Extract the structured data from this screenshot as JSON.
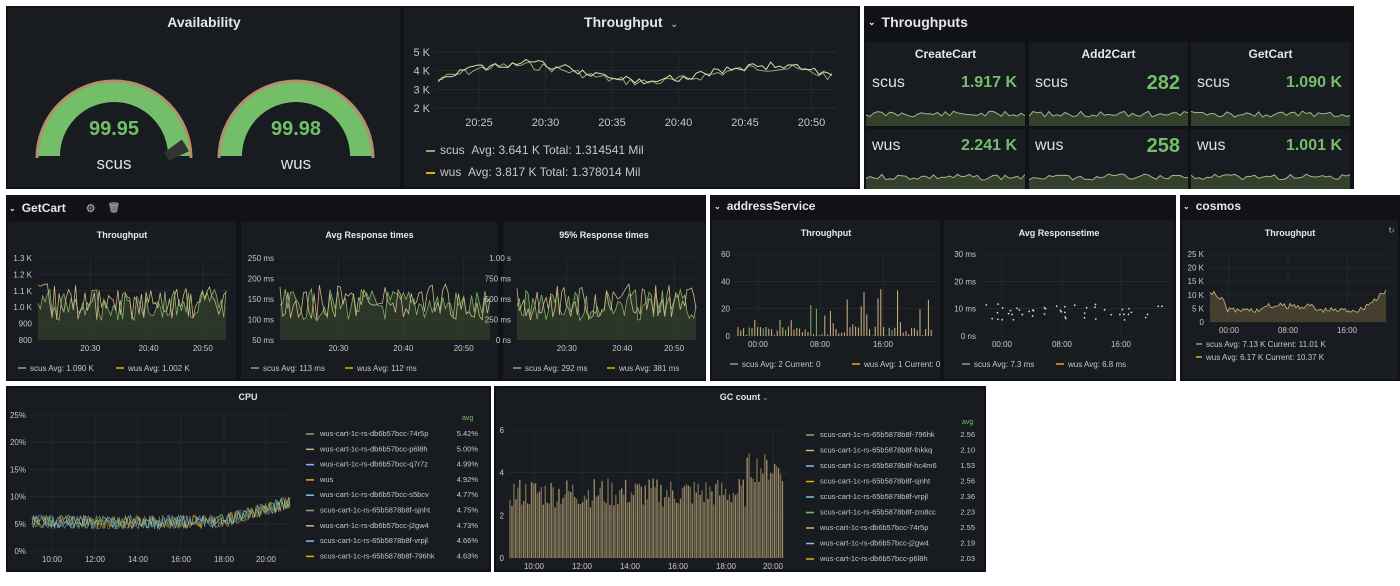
{
  "availability": {
    "title": "Availability",
    "gauges": [
      {
        "value": "99.95",
        "label": "scus",
        "fill": 0.9995
      },
      {
        "value": "99.98",
        "label": "wus",
        "fill": 0.9998
      }
    ]
  },
  "throughput": {
    "title": "Throughput",
    "dropdown_icon": "chevron-down-icon",
    "y_ticks": [
      "5 K",
      "4 K",
      "3 K",
      "2 K"
    ],
    "x_ticks": [
      "20:25",
      "20:30",
      "20:35",
      "20:40",
      "20:45",
      "20:50"
    ],
    "legend": [
      {
        "name": "scus",
        "text": "Avg: 3.641 K  Total: 1.314541 Mil"
      },
      {
        "name": "wus",
        "text": "Avg: 3.817 K  Total: 1.378014 Mil"
      }
    ]
  },
  "throughputs": {
    "row_title": "Throughputs",
    "columns": [
      {
        "title": "CreateCart",
        "rows": [
          {
            "region": "scus",
            "value": "1.917 K"
          },
          {
            "region": "wus",
            "value": "2.241 K"
          }
        ]
      },
      {
        "title": "Add2Cart",
        "rows": [
          {
            "region": "scus",
            "value": "282"
          },
          {
            "region": "wus",
            "value": "258"
          }
        ]
      },
      {
        "title": "GetCart",
        "rows": [
          {
            "region": "scus",
            "value": "1.090 K"
          },
          {
            "region": "wus",
            "value": "1.001 K"
          }
        ]
      }
    ]
  },
  "getcart": {
    "row_title": "GetCart",
    "panels": [
      {
        "title": "Throughput",
        "y_ticks": [
          "1.3 K",
          "1.2 K",
          "1.1 K",
          "1.0 K",
          "900",
          "800"
        ],
        "x_ticks": [
          "20:30",
          "20:40",
          "20:50"
        ],
        "legend": [
          {
            "name": "scus",
            "text": "Avg: 1.090 K"
          },
          {
            "name": "wus",
            "text": "Avg: 1.002 K"
          }
        ]
      },
      {
        "title": "Avg Response times",
        "y_ticks": [
          "250 ms",
          "200 ms",
          "150 ms",
          "100 ms",
          "50 ms"
        ],
        "x_ticks": [
          "20:30",
          "20:40",
          "20:50"
        ],
        "legend": [
          {
            "name": "scus",
            "text": "Avg: 113 ms"
          },
          {
            "name": "wus",
            "text": "Avg: 112 ms"
          }
        ]
      },
      {
        "title": "95% Response times",
        "y_ticks": [
          "1.00 s",
          "750 ms",
          "500 ms",
          "250 ms",
          "0 ns"
        ],
        "x_ticks": [
          "20:30",
          "20:40",
          "20:50"
        ],
        "legend": [
          {
            "name": "scus",
            "text": "Avg: 292 ms"
          },
          {
            "name": "wus",
            "text": "Avg: 381 ms"
          }
        ]
      }
    ]
  },
  "address_service": {
    "row_title": "addressService",
    "panels": [
      {
        "title": "Throughput",
        "y_ticks": [
          "60",
          "40",
          "20",
          "0"
        ],
        "x_ticks": [
          "00:00",
          "08:00",
          "16:00"
        ],
        "legend": [
          {
            "name": "scus",
            "text": "Avg: 2  Current: 0"
          },
          {
            "name": "wus",
            "text": "Avg: 1  Current: 0"
          }
        ]
      },
      {
        "title": "Avg Responsetime",
        "y_ticks": [
          "30 ms",
          "20 ms",
          "10 ms",
          "0 ns"
        ],
        "x_ticks": [
          "00:00",
          "08:00",
          "16:00"
        ],
        "legend": [
          {
            "name": "scus",
            "text": "Avg: 7.3 ms"
          },
          {
            "name": "wus",
            "text": "Avg: 6.8 ms"
          }
        ]
      }
    ]
  },
  "cosmos": {
    "row_title": "cosmos",
    "panel": {
      "title": "Throughput",
      "y_ticks": [
        "25 K",
        "20 K",
        "15 K",
        "10 K",
        "5 K",
        "0"
      ],
      "x_ticks": [
        "00:00",
        "08:00",
        "16:00"
      ],
      "legend": [
        {
          "name": "scus",
          "text": "Avg: 7.13 K  Current: 11.01 K"
        },
        {
          "name": "wus",
          "text": "Avg: 6.17 K  Current: 10.37 K"
        }
      ]
    }
  },
  "cpu": {
    "title": "CPU",
    "y_ticks": [
      "25%",
      "20%",
      "15%",
      "10%",
      "5%",
      "0%"
    ],
    "x_ticks": [
      "10:00",
      "12:00",
      "14:00",
      "16:00",
      "18:00",
      "20:00"
    ],
    "avg_header": "avg",
    "legend": [
      {
        "name": "wus-cart-1c-rs-db6b57bcc-74r5p",
        "avg": "5.42%"
      },
      {
        "name": "wus-cart-1c-rs-db6b57bcc-p6l8h",
        "avg": "5.00%"
      },
      {
        "name": "wus-cart-1c-rs-db6b57bcc-q7r7z",
        "avg": "4.99%"
      },
      {
        "name": "wus",
        "avg": "4.92%"
      },
      {
        "name": "wus-cart-1c-rs-db6b57bcc-s5bcv",
        "avg": "4.77%"
      },
      {
        "name": "scus-cart-1c-rs-65b5878b8f-sjnht",
        "avg": "4.75%"
      },
      {
        "name": "wus-cart-1c-rs-db6b57bcc-j2gw4",
        "avg": "4.73%"
      },
      {
        "name": "scus-cart-1c-rs-65b5878b8f-vrpjl",
        "avg": "4.66%"
      },
      {
        "name": "scus-cart-1c-rs-65b5878b8f-796hk",
        "avg": "4.63%"
      }
    ]
  },
  "gc": {
    "title": "GC count",
    "y_ticks": [
      "6",
      "4",
      "2",
      "0"
    ],
    "x_ticks": [
      "10:00",
      "12:00",
      "14:00",
      "16:00",
      "18:00",
      "20:00"
    ],
    "avg_header": "avg",
    "legend": [
      {
        "name": "scus-cart-1c-rs-65b5878b8f-796hk",
        "avg": "2.56"
      },
      {
        "name": "scus-cart-1c-rs-65b5878b8f-fnkkq",
        "avg": "2.10"
      },
      {
        "name": "scus-cart-1c-rs-65b5878b8f-hc4m6",
        "avg": "1.53"
      },
      {
        "name": "scus-cart-1c-rs-65b5878b8f-sjnht",
        "avg": "2.56"
      },
      {
        "name": "scus-cart-1c-rs-65b5878b8f-vrpjl",
        "avg": "2.36"
      },
      {
        "name": "scus-cart-1c-rs-65b5878b8f-zm8cc",
        "avg": "2.23"
      },
      {
        "name": "wus-cart-1c-rs-db6b57bcc-74r5p",
        "avg": "2.55"
      },
      {
        "name": "wus-cart-1c-rs-db6b57bcc-j2gw4",
        "avg": "2.19"
      },
      {
        "name": "wus-cart-1c-rs-db6b57bcc-p6l8h",
        "avg": "2.03"
      }
    ]
  },
  "colors": {
    "green": "#73bf69",
    "scus_line": "#7eb26d",
    "wus_line": "#e5ac0e",
    "tan": "#cfb77f",
    "bg": "#181b1f",
    "grid": "#2b2f35"
  }
}
